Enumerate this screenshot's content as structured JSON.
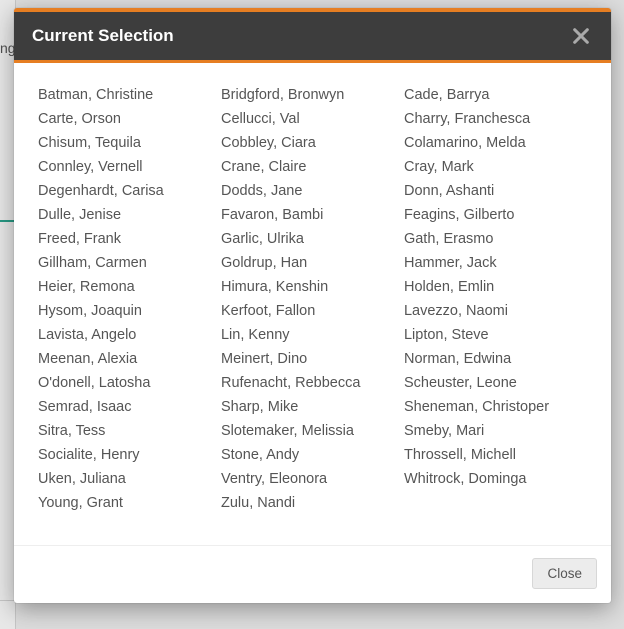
{
  "modal": {
    "title": "Current Selection",
    "close_label": "Close"
  },
  "columns": [
    [
      "Batman, Christine",
      "Carte, Orson",
      "Chisum, Tequila",
      "Connley, Vernell",
      "Degenhardt, Carisa",
      "Dulle, Jenise",
      "Freed, Frank",
      "Gillham, Carmen",
      "Heier, Remona",
      "Hysom, Joaquin",
      "Lavista, Angelo",
      "Meenan, Alexia",
      "O'donell, Latosha",
      "Semrad, Isaac",
      "Sitra, Tess",
      "Socialite, Henry",
      "Uken, Juliana",
      "Young, Grant"
    ],
    [
      "Bridgford, Bronwyn",
      "Cellucci, Val",
      "Cobbley, Ciara",
      "Crane, Claire",
      "Dodds, Jane",
      "Favaron, Bambi",
      "Garlic, Ulrika",
      "Goldrup, Han",
      "Himura, Kenshin",
      "Kerfoot, Fallon",
      "Lin, Kenny",
      "Meinert, Dino",
      "Rufenacht, Rebbecca",
      "Sharp, Mike",
      "Slotemaker, Melissia",
      "Stone, Andy",
      "Ventry, Eleonora",
      "Zulu, Nandi"
    ],
    [
      "Cade, Barrya",
      "Charry, Franchesca",
      "Colamarino, Melda",
      "Cray, Mark",
      "Donn, Ashanti",
      "Feagins, Gilberto",
      "Gath, Erasmo",
      "Hammer, Jack",
      "Holden, Emlin",
      "Lavezzo, Naomi",
      "Lipton, Steve",
      "Norman, Edwina",
      "Scheuster, Leone",
      "Sheneman, Christoper",
      "Smeby, Mari",
      "Throssell, Michell",
      "Whitrock, Dominga"
    ]
  ]
}
